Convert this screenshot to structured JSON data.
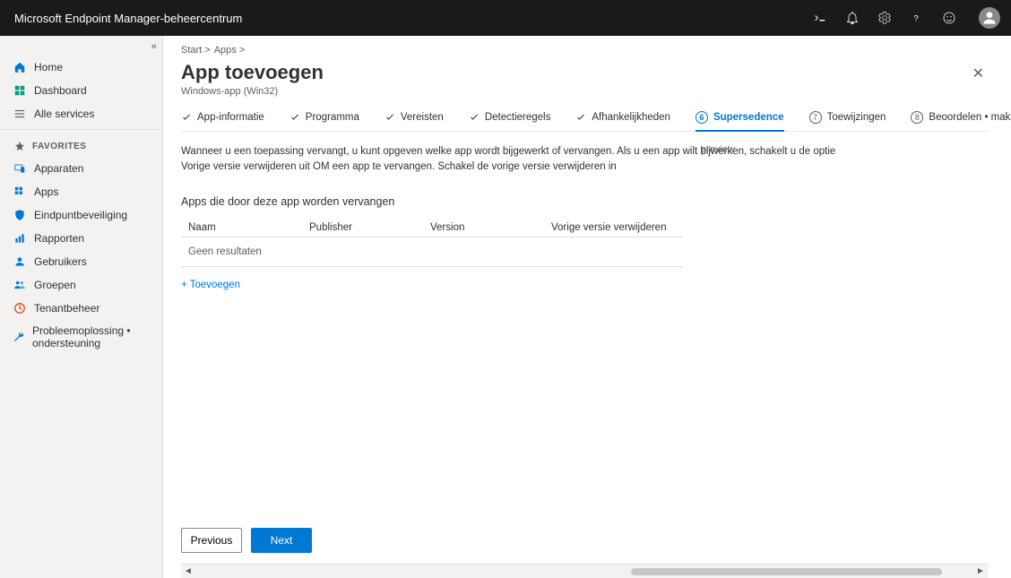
{
  "topbar": {
    "title": "Microsoft Endpoint Manager-beheercentrum"
  },
  "sidebar": {
    "home": "Home",
    "dashboard": "Dashboard",
    "all_services": "Alle services",
    "favorites_label": "FAVORITES",
    "devices": "Apparaten",
    "apps": "Apps",
    "endpoint_security": "Eindpuntbeveiliging",
    "reports": "Rapporten",
    "users": "Gebruikers",
    "groups": "Groepen",
    "tenant_admin": "Tenantbeheer",
    "troubleshoot": "Probleemoplossing • ondersteuning"
  },
  "breadcrumb": {
    "start": "Start >",
    "apps": "Apps >"
  },
  "panel": {
    "title": "App toevoegen",
    "subtitle": "Windows-app (Win32)"
  },
  "wizard": {
    "app_info": "App-informatie",
    "program": "Programma",
    "requirements": "Vereisten",
    "detection": "Detectieregels",
    "dependencies": "Afhankelijkheden",
    "supersedence": "Supersedence",
    "supersedence_num": "6",
    "assignments": "Toewijzingen",
    "assignments_num": "7",
    "review": "Beoordelen • maken",
    "review_num": "8"
  },
  "body": {
    "description": "Wanneer u een toepassing vervangt, u kunt opgeven welke app wordt bijgewerkt of vervangen. Als u een app wilt bijwerken, schakelt u de optie Vorige versie verwijderen uit OM een app te vervangen. Schakel de vorige versie verwijderen in",
    "preview_tag": "preview",
    "section_title": "Apps die door deze app worden vervangen",
    "col_name": "Naam",
    "col_publisher": "Publisher",
    "col_version": "Version",
    "col_delete_prev": "Vorige versie verwijderen",
    "no_results": "Geen resultaten",
    "add_link": "+ Toevoegen"
  },
  "footer": {
    "previous": "Previous",
    "next": "Next"
  }
}
